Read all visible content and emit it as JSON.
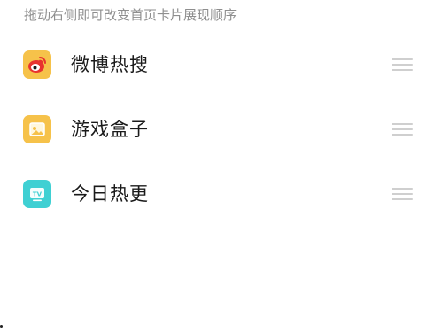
{
  "hint": "拖动右侧即可改变首页卡片展现顺序",
  "items": [
    {
      "label": "微博热搜",
      "icon": "weibo-icon",
      "color": "#f6c24a"
    },
    {
      "label": "游戏盒子",
      "icon": "game-box-icon",
      "color": "#f6c24a"
    },
    {
      "label": "今日热更",
      "icon": "tv-icon",
      "color": "#3fd0d3"
    }
  ]
}
